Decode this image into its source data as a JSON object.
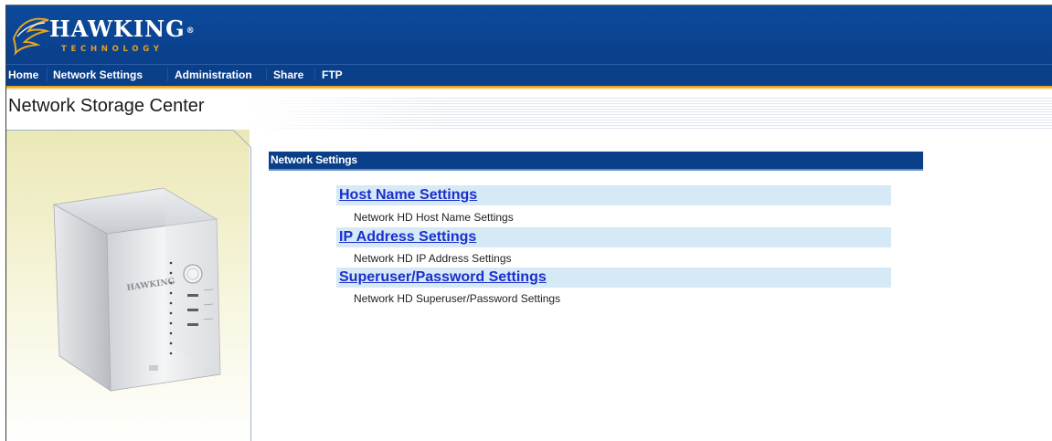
{
  "brand": {
    "name": "HAWKING",
    "registered": "®",
    "subtitle": "TECHNOLOGY"
  },
  "nav": {
    "items": [
      {
        "label": "Home"
      },
      {
        "label": "Network Settings"
      },
      {
        "label": "Administration"
      },
      {
        "label": "Share"
      },
      {
        "label": "FTP"
      }
    ]
  },
  "page": {
    "title": "Network Storage Center"
  },
  "sidebar": {
    "device_brand": "HAWKING"
  },
  "main": {
    "section_title": "Network Settings",
    "links": [
      {
        "title": "Host Name Settings",
        "description": "Network HD Host Name Settings"
      },
      {
        "title": "IP Address Settings",
        "description": "Network HD IP Address Settings"
      },
      {
        "title": "Superuser/Password Settings",
        "description": "Network HD Superuser/Password Settings"
      }
    ]
  },
  "colors": {
    "header_blue": "#0a3f8a",
    "nav_accent": "#e6a420",
    "link_blue": "#1a2fcc",
    "link_bar_bg": "#d6e9f6",
    "sidebar_bg": "#ebe8b6"
  }
}
